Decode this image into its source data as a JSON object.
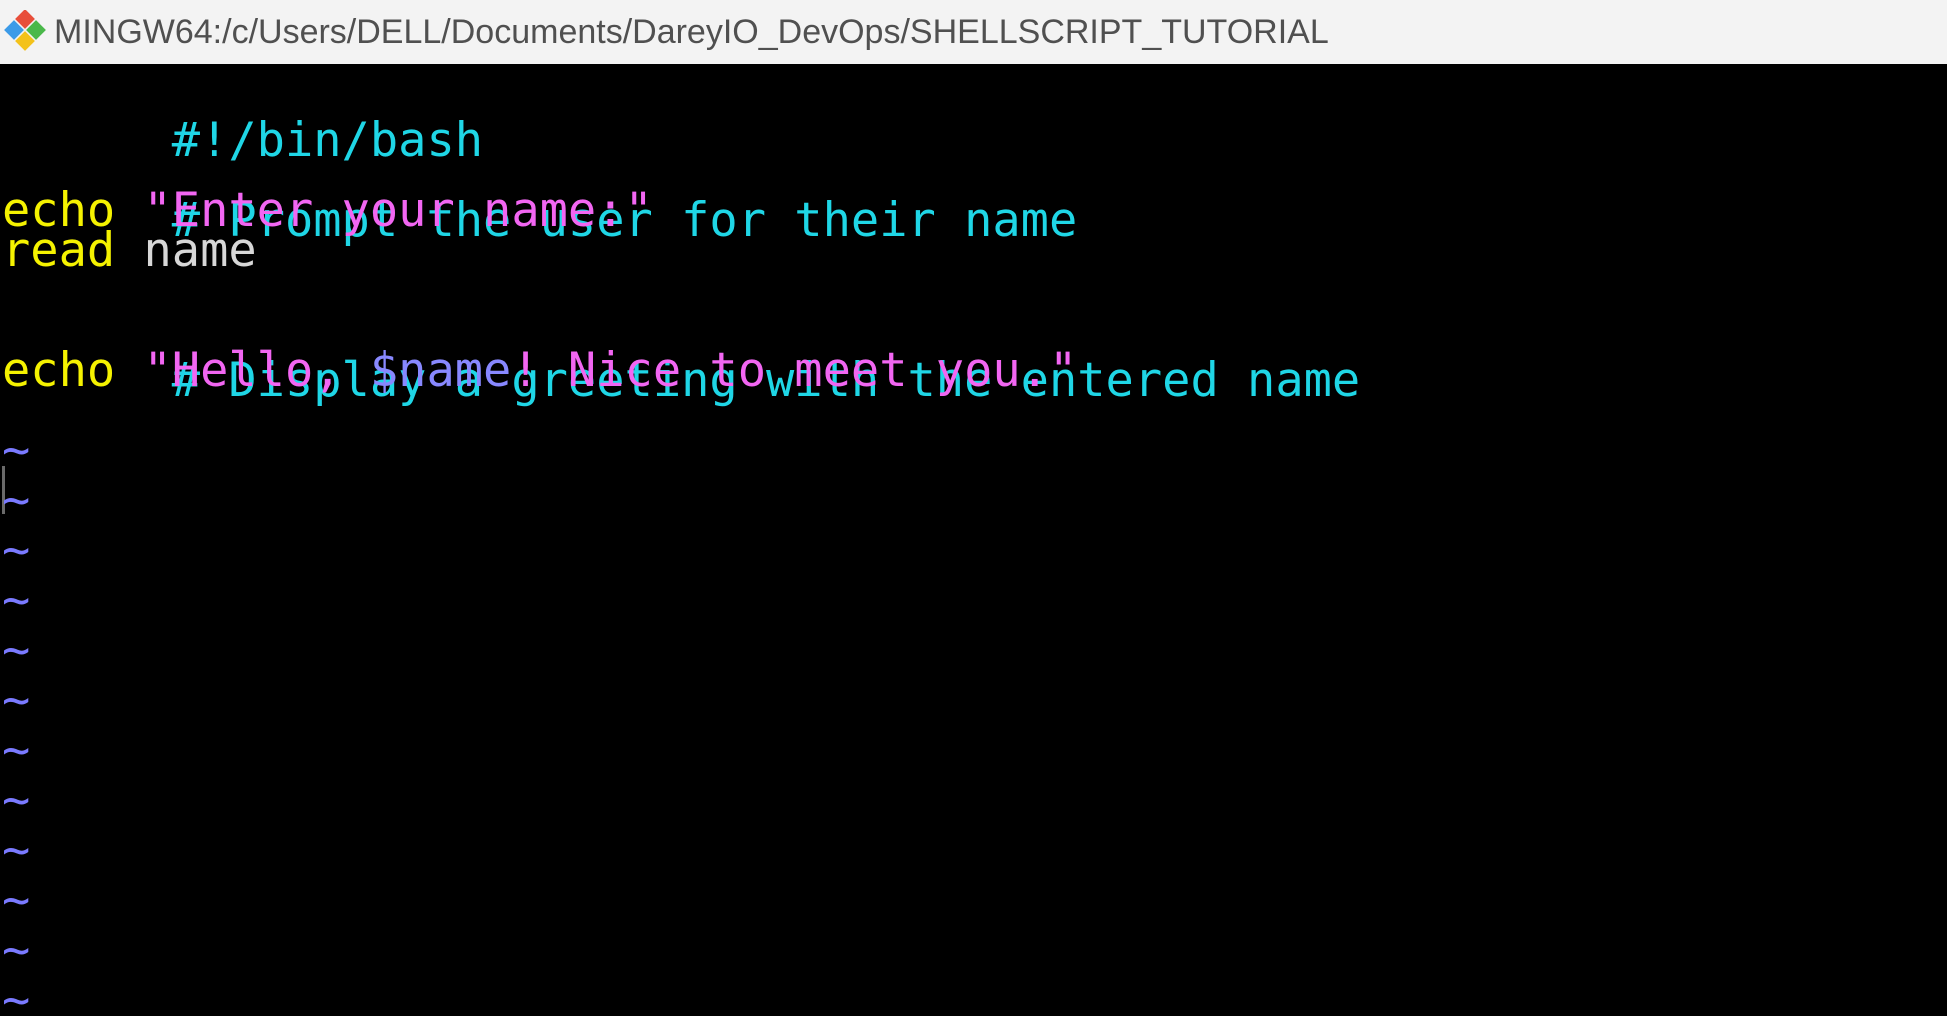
{
  "window": {
    "title": "MINGW64:/c/Users/DELL/Documents/DareyIO_DevOps/SHELLSCRIPT_TUTORIAL",
    "icon": "git-bash-icon"
  },
  "editor": {
    "colors": {
      "comment": "#1fd6e6",
      "keyword": "#f5f200",
      "string": "#f266f2",
      "variable": "#8888ff",
      "plain": "#d7d7d7",
      "tilde": "#7a7aff",
      "background": "#000000"
    },
    "lines": {
      "shebang": "#!/bin/bash",
      "comment1": "# Prompt the user for their name",
      "echo1_kw": "echo",
      "echo1_str": "\"Enter your name:\"",
      "read_kw": "read",
      "read_var": "name",
      "comment2": "# Display a greeting with the entered name",
      "echo2_kw": "echo",
      "echo2_str_a": "\"Hello, ",
      "echo2_var": "$name",
      "echo2_str_b": "! Nice to meet you.\""
    },
    "tilde_char": "~"
  }
}
